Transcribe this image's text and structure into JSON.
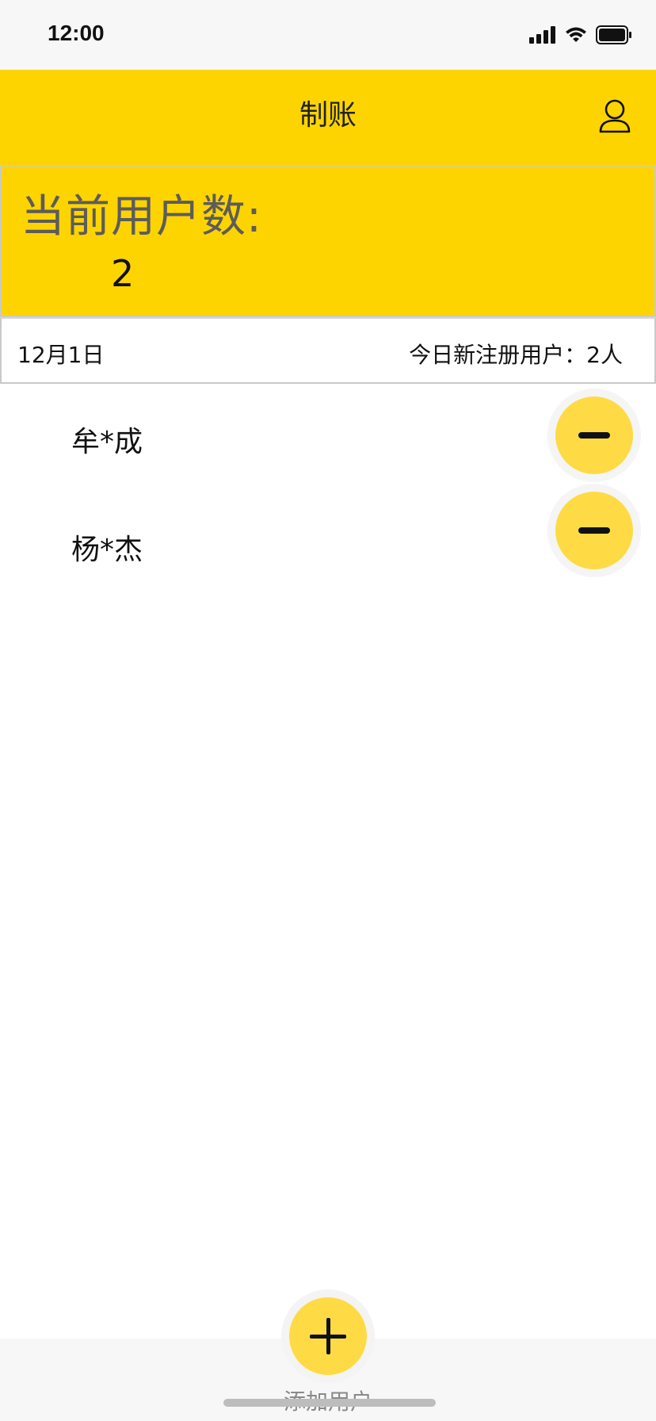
{
  "status_bar": {
    "time": "12:00"
  },
  "nav": {
    "title": "制账",
    "profile_icon": "person-outline-icon"
  },
  "summary": {
    "label": "当前用户数:",
    "value": "2"
  },
  "date_row": {
    "date": "12月1日",
    "new_users_text": "今日新注册用户：2人"
  },
  "users": [
    {
      "name": "牟*成",
      "action_icon": "minus-icon"
    },
    {
      "name": "杨*杰",
      "action_icon": "minus-icon"
    }
  ],
  "bottom": {
    "add_label": "添加用户",
    "add_icon": "plus-icon"
  },
  "colors": {
    "accent": "#fdd400",
    "button": "#fedb44",
    "divider": "#c9c9c9"
  }
}
